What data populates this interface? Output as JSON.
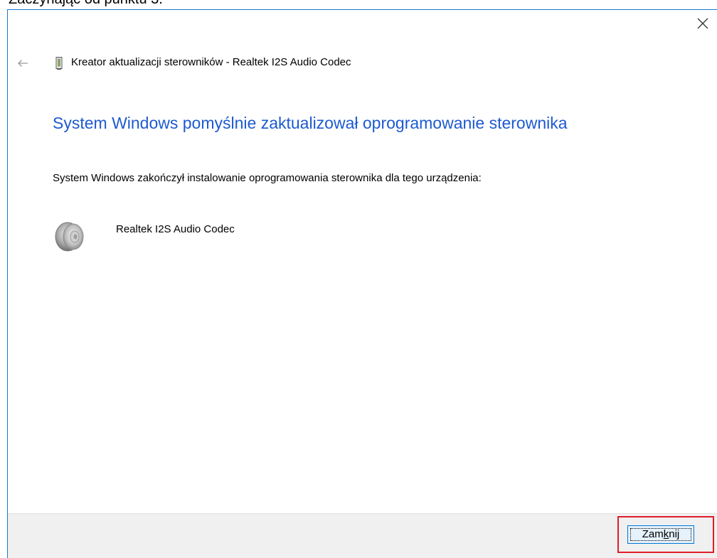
{
  "caption": "Zaczynając od punktu 3.",
  "dialog": {
    "title": "Kreator aktualizacji sterowników - Realtek I2S Audio Codec",
    "heading": "System Windows pomyślnie zaktualizował oprogramowanie sterownika",
    "description": "System Windows zakończył instalowanie oprogramowania sterownika dla tego urządzenia:",
    "device_name": "Realtek I2S Audio Codec",
    "buttons": {
      "close_label_pre": "Zam",
      "close_label_access": "k",
      "close_label_post": "nij"
    }
  },
  "colors": {
    "heading": "#1d5ad0",
    "border": "#1979ca",
    "highlight": "#e01e2a",
    "footer": "#f0f0f0"
  },
  "icons": {
    "close": "close-icon",
    "back": "back-arrow-icon",
    "wizard": "device-card-icon",
    "device": "speaker-icon"
  }
}
